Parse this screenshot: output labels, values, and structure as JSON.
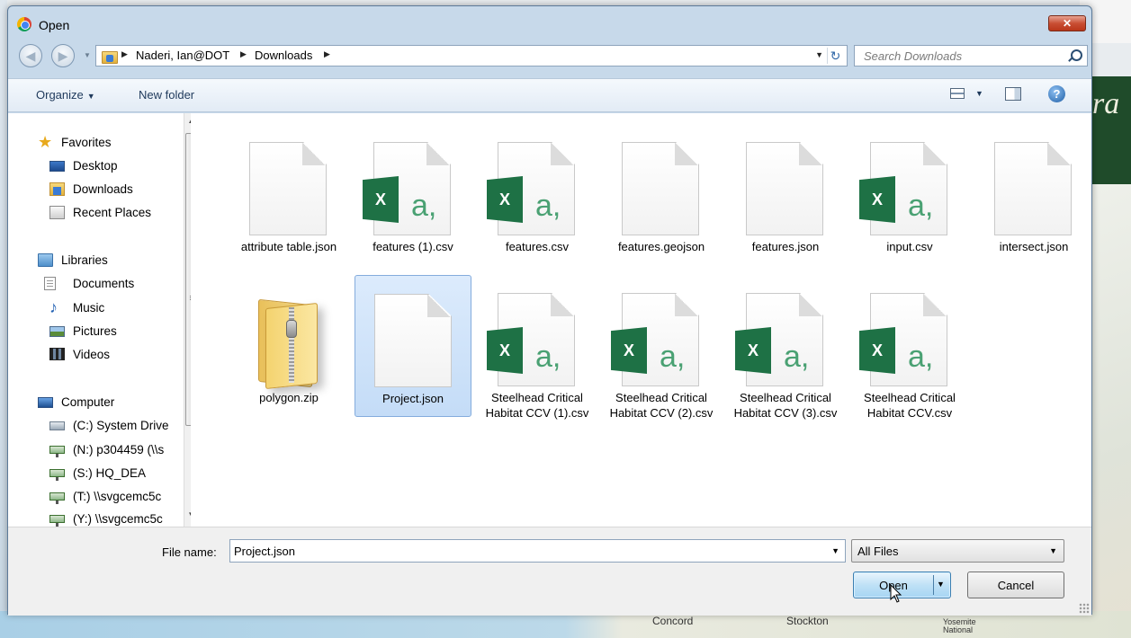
{
  "window": {
    "title": "Open",
    "close_label": "✕"
  },
  "nav": {
    "breadcrumbs": [
      "Naderi, Ian@DOT",
      "Downloads"
    ],
    "search_placeholder": "Search Downloads"
  },
  "toolbar": {
    "organize_label": "Organize",
    "new_folder_label": "New folder",
    "help_label": "?"
  },
  "sidebar": {
    "favorites": {
      "label": "Favorites",
      "items": [
        "Desktop",
        "Downloads",
        "Recent Places"
      ]
    },
    "libraries": {
      "label": "Libraries",
      "items": [
        "Documents",
        "Music",
        "Pictures",
        "Videos"
      ]
    },
    "computer": {
      "label": "Computer",
      "items": [
        "(C:) System Drive",
        "(N:) p304459 (\\\\s",
        "(S:) HQ_DEA",
        "(T:) \\\\svgcemc5c",
        "(Y:) \\\\svgcemc5c"
      ]
    }
  },
  "files": [
    {
      "name": "attribute table.json",
      "icon": "blank-document-icon"
    },
    {
      "name": "features (1).csv",
      "icon": "excel-csv-icon"
    },
    {
      "name": "features.csv",
      "icon": "excel-csv-icon"
    },
    {
      "name": "features.geojson",
      "icon": "blank-document-icon"
    },
    {
      "name": "features.json",
      "icon": "blank-document-icon"
    },
    {
      "name": "input.csv",
      "icon": "excel-csv-icon"
    },
    {
      "name": "intersect.json",
      "icon": "blank-document-icon"
    },
    {
      "name": "polygon.zip",
      "icon": "zip-folder-icon"
    },
    {
      "name": "Project.json",
      "icon": "blank-document-icon",
      "selected": true
    },
    {
      "name": "Steelhead Critical Habitat CCV (1).csv",
      "icon": "excel-csv-icon"
    },
    {
      "name": "Steelhead Critical Habitat CCV (2).csv",
      "icon": "excel-csv-icon"
    },
    {
      "name": "Steelhead Critical Habitat CCV (3).csv",
      "icon": "excel-csv-icon"
    },
    {
      "name": "Steelhead Critical Habitat CCV.csv",
      "icon": "excel-csv-icon"
    }
  ],
  "bottom": {
    "file_name_label": "File name:",
    "file_name_value": "Project.json",
    "file_type": "All Files",
    "open_label": "Open",
    "cancel_label": "Cancel"
  },
  "background": {
    "title_fragment": "ra",
    "map_labels": [
      "Concord",
      "Stockton",
      "Yosemite National"
    ]
  },
  "colors": {
    "excel_green": "#1e7145",
    "selection": "#cce0f8",
    "titlebar": "#c7d9ea"
  }
}
